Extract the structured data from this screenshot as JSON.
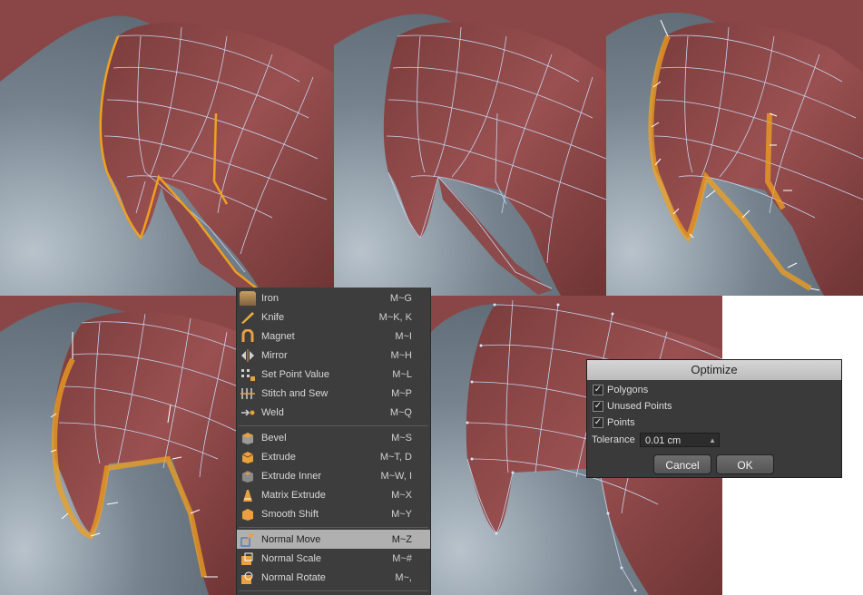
{
  "menu": {
    "items": [
      {
        "label": "Iron",
        "shortcut": "M~G",
        "icon": "iron-icon"
      },
      {
        "label": "Knife",
        "shortcut": "M~K, K",
        "icon": "knife-icon"
      },
      {
        "label": "Magnet",
        "shortcut": "M~I",
        "icon": "magnet-icon"
      },
      {
        "label": "Mirror",
        "shortcut": "M~H",
        "icon": "mirror-icon"
      },
      {
        "label": "Set Point Value",
        "shortcut": "M~L",
        "icon": "set-point-value-icon"
      },
      {
        "label": "Stitch and Sew",
        "shortcut": "M~P",
        "icon": "stitch-and-sew-icon"
      },
      {
        "label": "Weld",
        "shortcut": "M~Q",
        "icon": "weld-icon"
      },
      {
        "label": "Bevel",
        "shortcut": "M~S",
        "icon": "bevel-icon"
      },
      {
        "label": "Extrude",
        "shortcut": "M~T, D",
        "icon": "extrude-icon"
      },
      {
        "label": "Extrude Inner",
        "shortcut": "M~W, I",
        "icon": "extrude-inner-icon"
      },
      {
        "label": "Matrix Extrude",
        "shortcut": "M~X",
        "icon": "matrix-extrude-icon"
      },
      {
        "label": "Smooth Shift",
        "shortcut": "M~Y",
        "icon": "smooth-shift-icon"
      },
      {
        "label": "Normal Move",
        "shortcut": "M~Z",
        "icon": "normal-move-icon",
        "selected": true
      },
      {
        "label": "Normal Scale",
        "shortcut": "M~#",
        "icon": "normal-scale-icon"
      },
      {
        "label": "Normal Rotate",
        "shortcut": "M~,",
        "icon": "normal-rotate-icon"
      }
    ]
  },
  "dialog": {
    "title": "Optimize",
    "options": [
      {
        "label": "Polygons",
        "checked": true
      },
      {
        "label": "Unused Points",
        "checked": true
      },
      {
        "label": "Points",
        "checked": true
      }
    ],
    "tolerance_label": "Tolerance",
    "tolerance_value": "0.01 cm",
    "cancel_label": "Cancel",
    "ok_label": "OK"
  },
  "colors": {
    "mesh": "#8a4848",
    "wire": "#c8d4f0",
    "selection": "#f0a020",
    "background": "#6f7c88"
  }
}
